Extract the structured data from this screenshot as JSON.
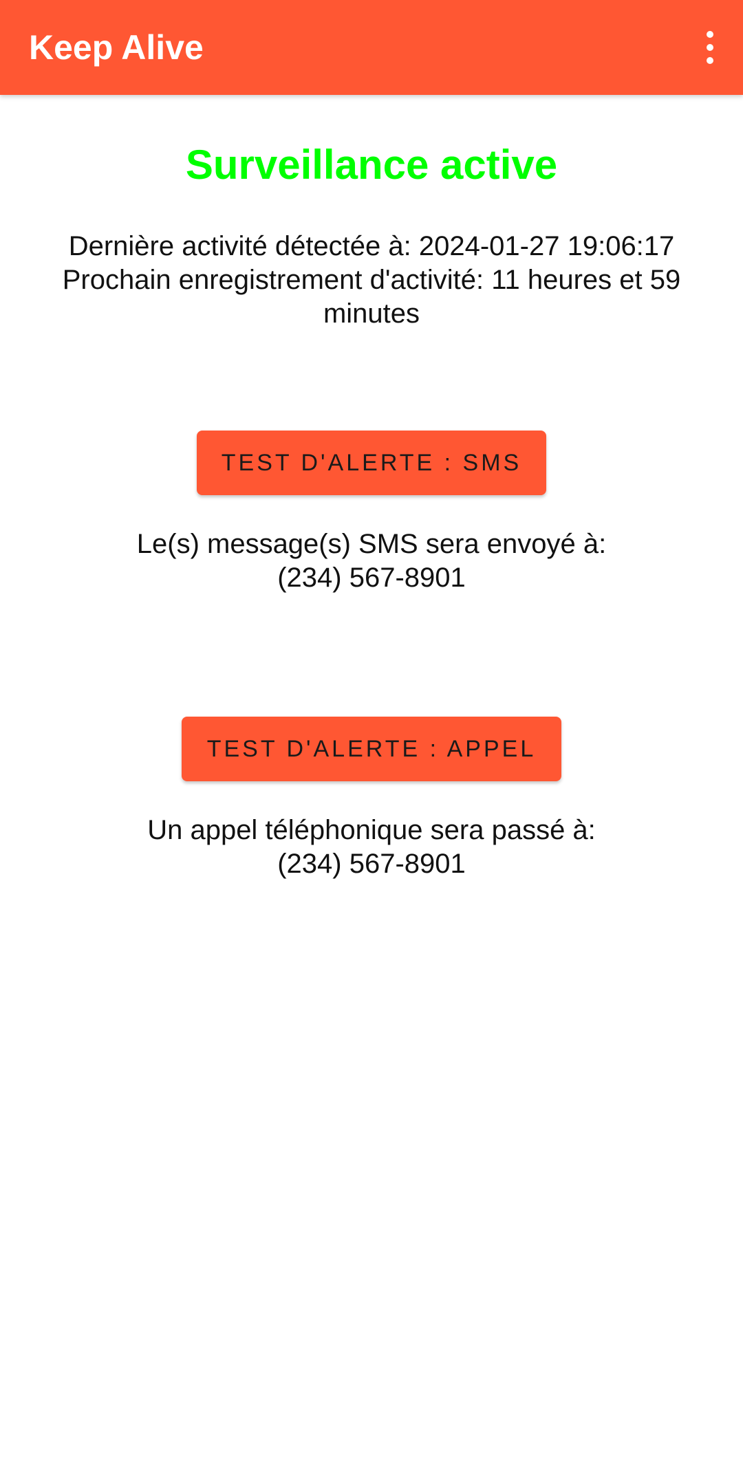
{
  "app_bar": {
    "title": "Keep Alive",
    "menu_icon": "more-vert-icon",
    "background_color": "#FF5733"
  },
  "status": {
    "title": "Surveillance active",
    "color": "#00FF00"
  },
  "activity": {
    "last_activity": "Dernière activité détectée à: 2024-01-27 19:06:17",
    "next_record": "Prochain enregistrement d'activité: 11 heures et 59 minutes"
  },
  "sms_alert": {
    "button_label": "TEST D'ALERTE : SMS",
    "info_line": "Le(s) message(s) SMS sera envoyé à:",
    "phone": "(234) 567-8901"
  },
  "call_alert": {
    "button_label": "TEST D'ALERTE : APPEL",
    "info_line": "Un appel téléphonique sera passé à:",
    "phone": "(234) 567-8901"
  }
}
